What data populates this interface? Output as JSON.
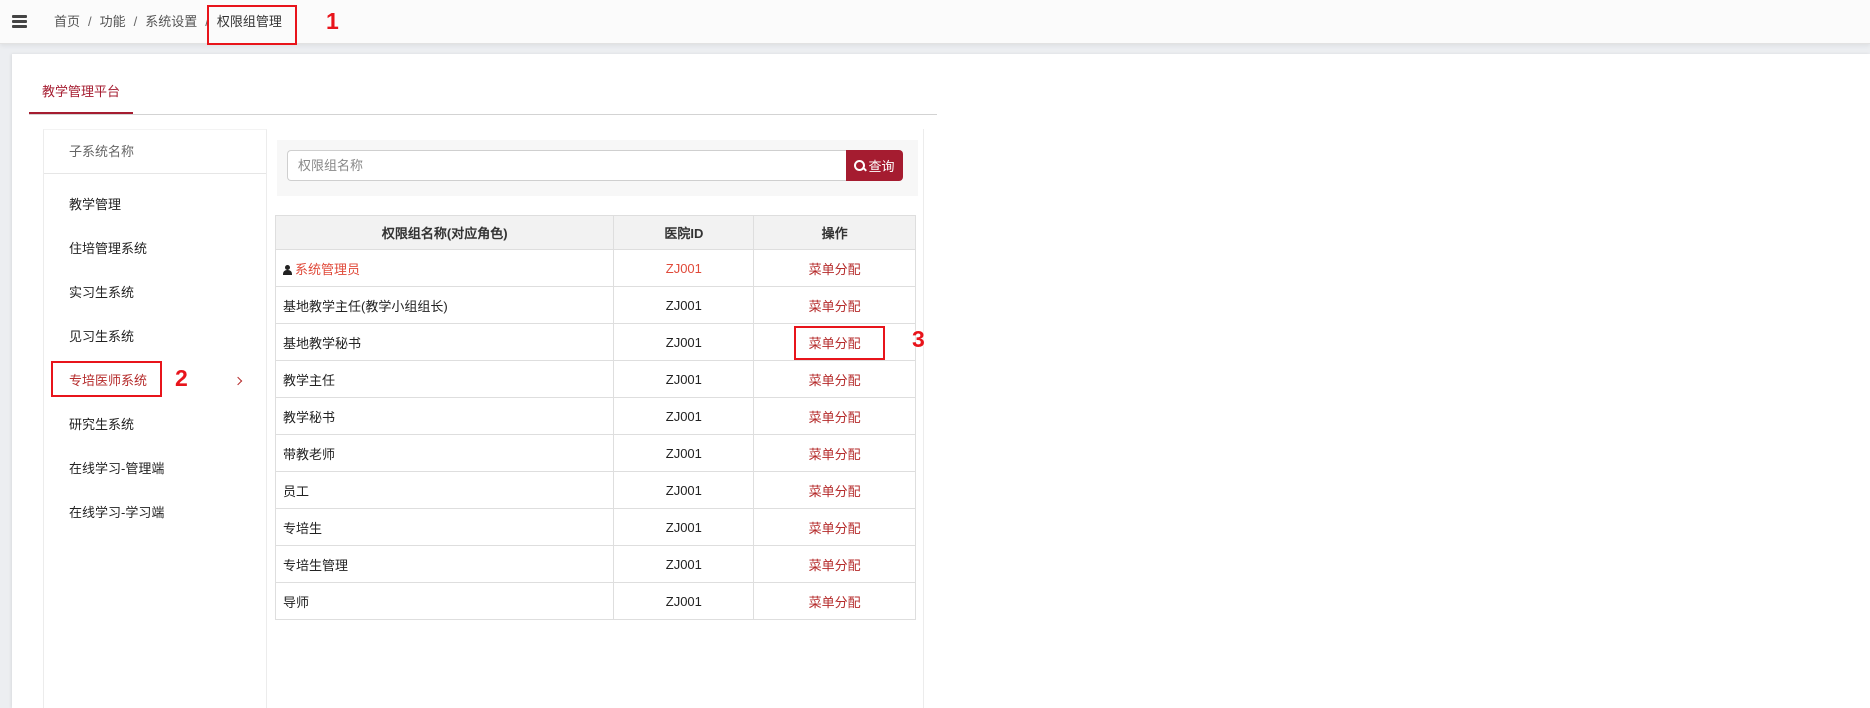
{
  "topbar": {
    "menu_icon": "hamburger-menu-icon",
    "breadcrumb": [
      "首页",
      "功能",
      "系统设置",
      "权限组管理"
    ],
    "separator": "/"
  },
  "annotations": {
    "one": "1",
    "two": "2",
    "three": "3"
  },
  "tab": {
    "label": "教学管理平台"
  },
  "sidebar": {
    "header": "子系统名称",
    "items": [
      "教学管理",
      "住培管理系统",
      "实习生系统",
      "见习生系统",
      "专培医师系统",
      "研究生系统",
      "在线学习-管理端",
      "在线学习-学习端"
    ],
    "active_index": 4,
    "active_icon": "chevron-right-icon"
  },
  "search": {
    "placeholder": "权限组名称",
    "button_label": "查询",
    "button_icon": "search-icon"
  },
  "table": {
    "headers": [
      "权限组名称(对应角色)",
      "医院ID",
      "操作"
    ],
    "rows": [
      {
        "name": "系统管理员",
        "hospital_id": "ZJ001",
        "action": "菜单分配",
        "highlight": true,
        "icon": "user-icon"
      },
      {
        "name": "基地教学主任(教学小组组长)",
        "hospital_id": "ZJ001",
        "action": "菜单分配"
      },
      {
        "name": "基地教学秘书",
        "hospital_id": "ZJ001",
        "action": "菜单分配"
      },
      {
        "name": "教学主任",
        "hospital_id": "ZJ001",
        "action": "菜单分配"
      },
      {
        "name": "教学秘书",
        "hospital_id": "ZJ001",
        "action": "菜单分配"
      },
      {
        "name": "带教老师",
        "hospital_id": "ZJ001",
        "action": "菜单分配"
      },
      {
        "name": "员工",
        "hospital_id": "ZJ001",
        "action": "菜单分配"
      },
      {
        "name": "专培生",
        "hospital_id": "ZJ001",
        "action": "菜单分配"
      },
      {
        "name": "专培生管理",
        "hospital_id": "ZJ001",
        "action": "菜单分配"
      },
      {
        "name": "导师",
        "hospital_id": "ZJ001",
        "action": "菜单分配"
      }
    ]
  },
  "colors": {
    "accent": "#a51c30",
    "link": "#b52b2b",
    "highlight": "#e04a3a",
    "annotation": "#e8141b"
  }
}
